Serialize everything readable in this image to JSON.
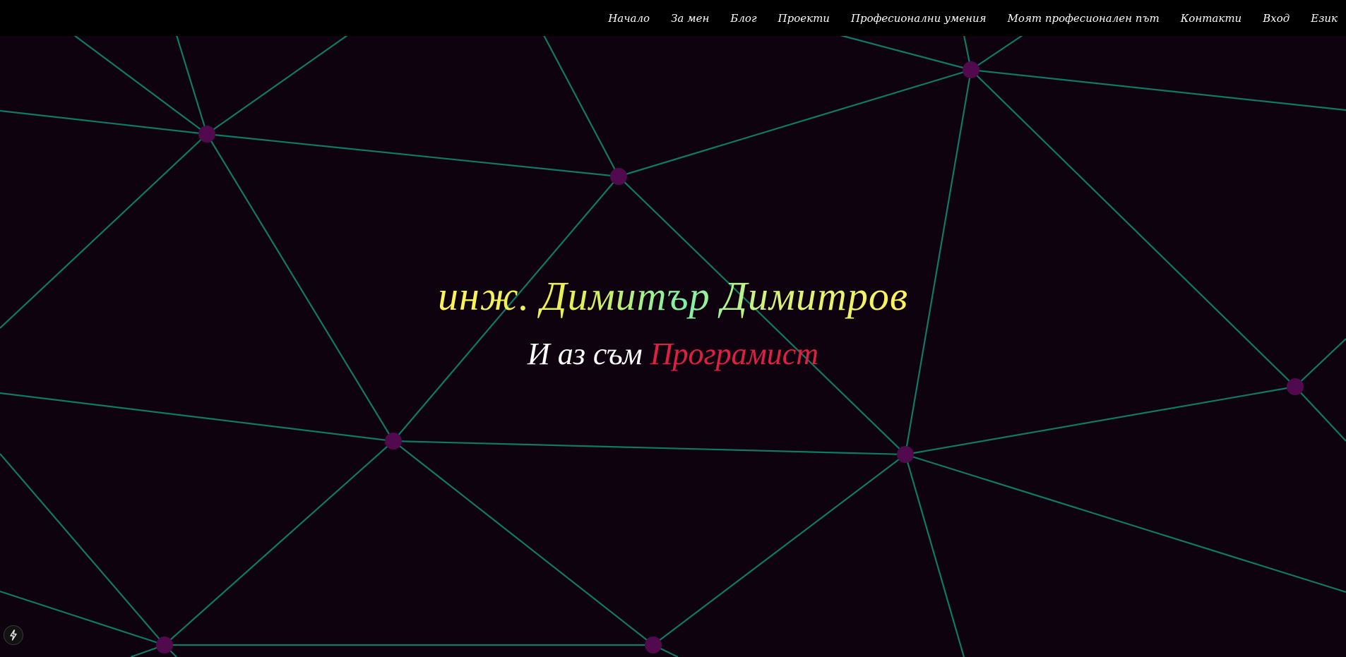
{
  "nav": {
    "items": [
      {
        "label": "Начало"
      },
      {
        "label": "За мен"
      },
      {
        "label": "Блог"
      },
      {
        "label": "Проекти"
      },
      {
        "label": "Професионални умения"
      },
      {
        "label": "Моят професионален път"
      },
      {
        "label": "Контакти"
      },
      {
        "label": "Вход"
      },
      {
        "label": "Език"
      }
    ]
  },
  "hero": {
    "title": "инж. Димитър Димитров",
    "subtitle_prefix": "И аз съм ",
    "subtitle_role": "Програмист"
  },
  "colors": {
    "background": "#0f020f",
    "navbar": "#000000",
    "network_line": "#0f7a63",
    "network_node": "#520a4e",
    "role_accent": "#e01f45",
    "title_gradient": [
      "#fff35a",
      "#7ef0a8"
    ]
  },
  "icons": {
    "corner_badge": "bolt-icon"
  }
}
